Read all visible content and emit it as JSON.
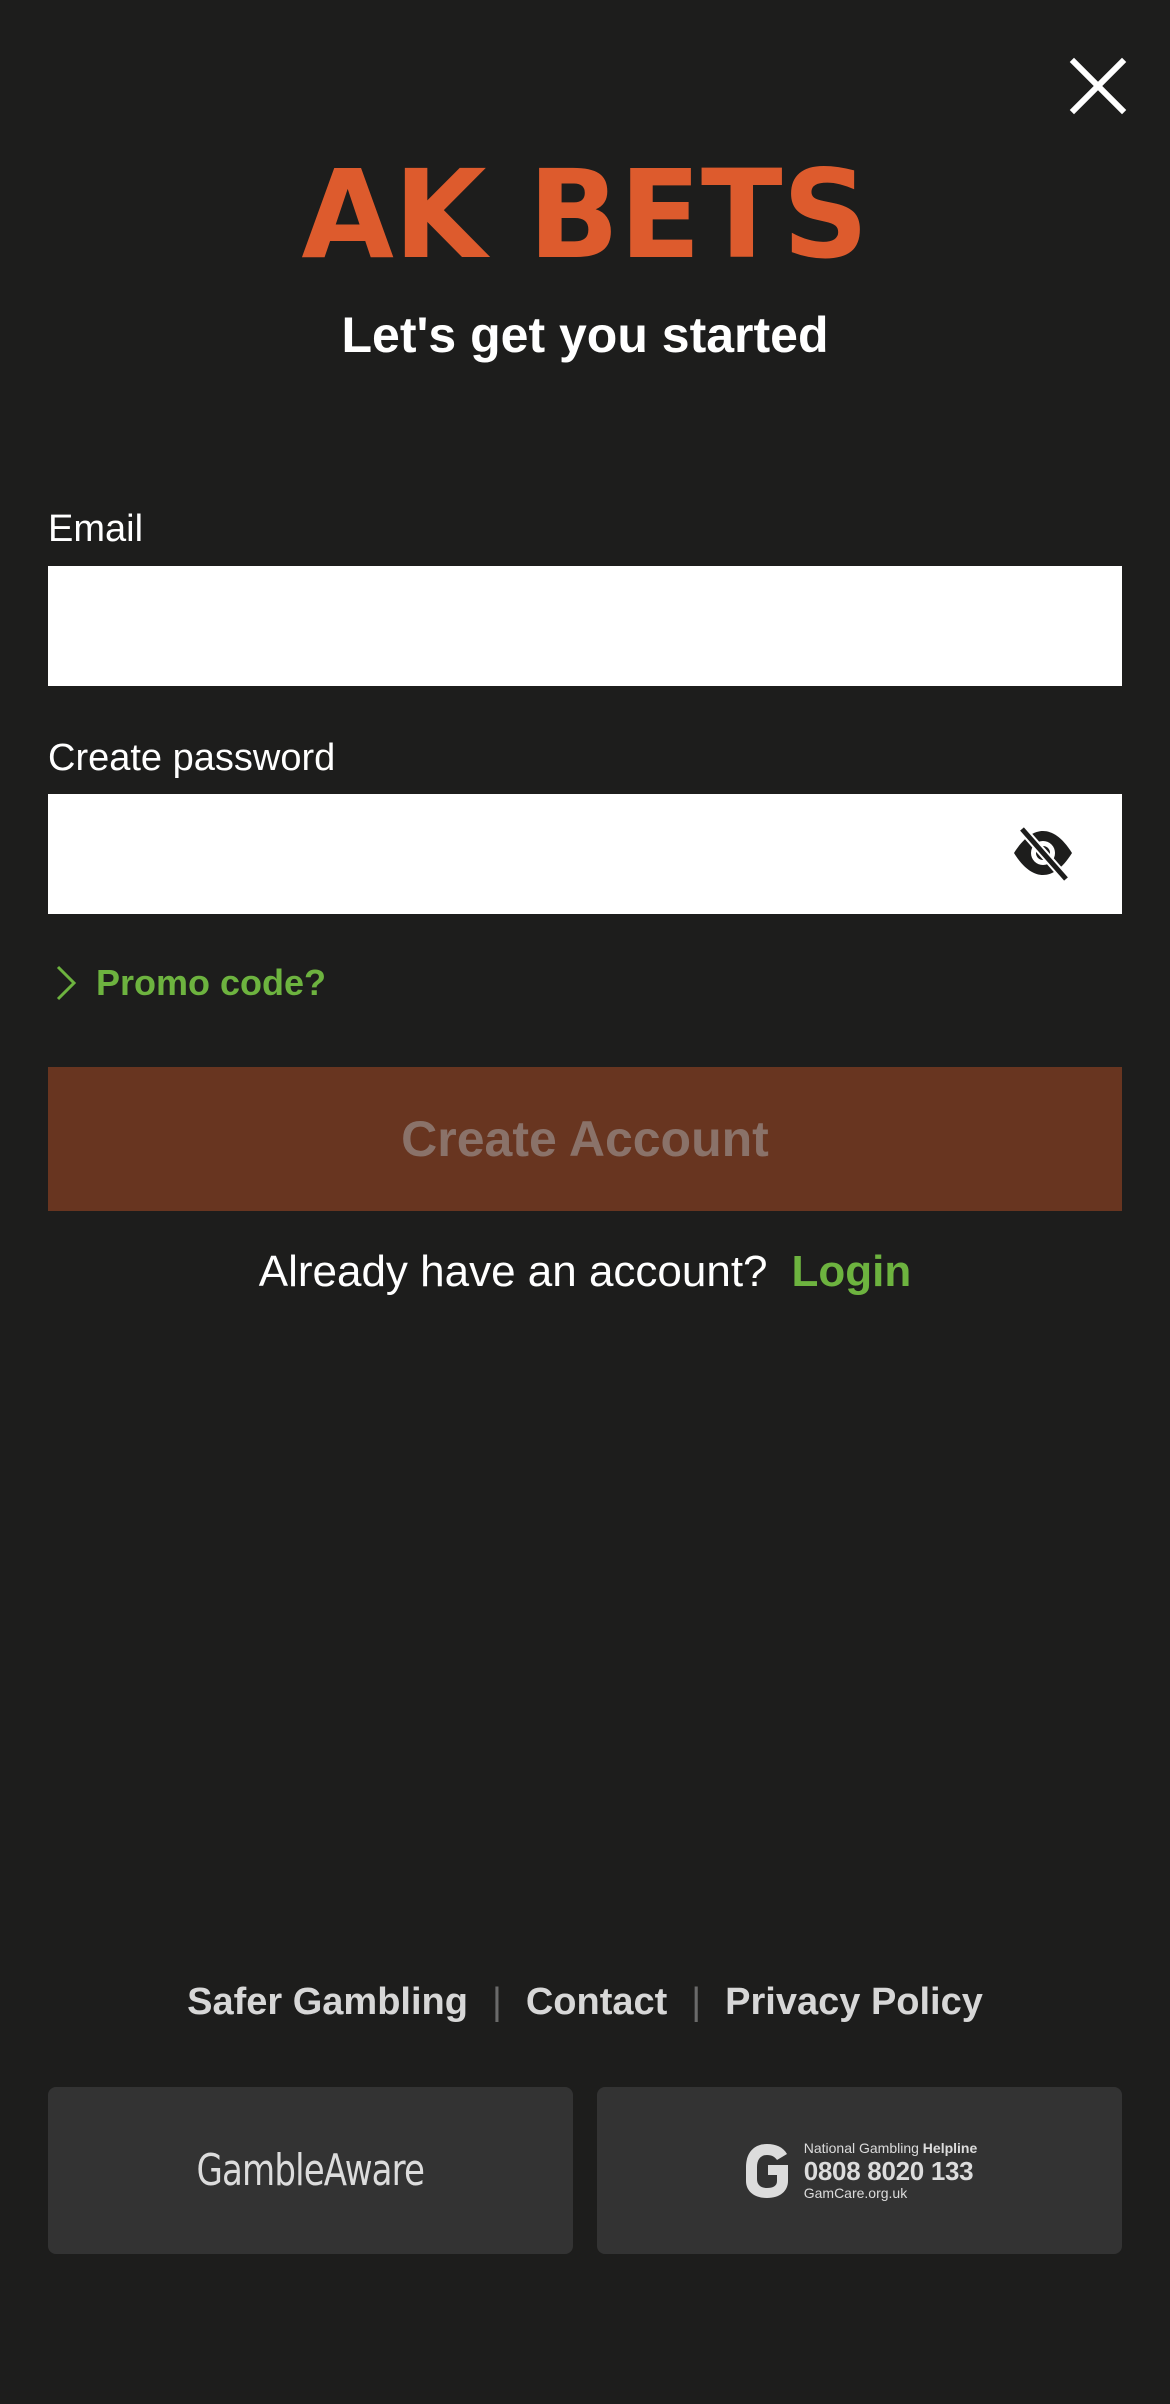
{
  "header": {
    "close_icon": "close-icon",
    "brand": "AK BETS",
    "subtitle": "Let's get you started",
    "brand_color": "#dd5b2d"
  },
  "form": {
    "email_label": "Email",
    "email_value": "",
    "password_label": "Create password",
    "password_value": "",
    "password_visibility_icon": "eye-off-icon",
    "promo_icon": "chevron-right-icon",
    "promo_label": "Promo code?",
    "submit_label": "Create Account",
    "submit_color": "#683520",
    "link_color": "#6db33f"
  },
  "login": {
    "prompt": "Already have an account?",
    "link": "Login"
  },
  "footer": {
    "links": [
      "Safer Gambling",
      "Contact",
      "Privacy Policy"
    ],
    "separator": "|",
    "gambleaware": "GambleAware",
    "helpline_prefix": "National Gambling",
    "helpline_label": "Helpline",
    "helpline_number": "0808 8020 133",
    "helpline_site": "GamCare.org.uk",
    "gamcare_icon": "gamcare-logo-icon"
  }
}
